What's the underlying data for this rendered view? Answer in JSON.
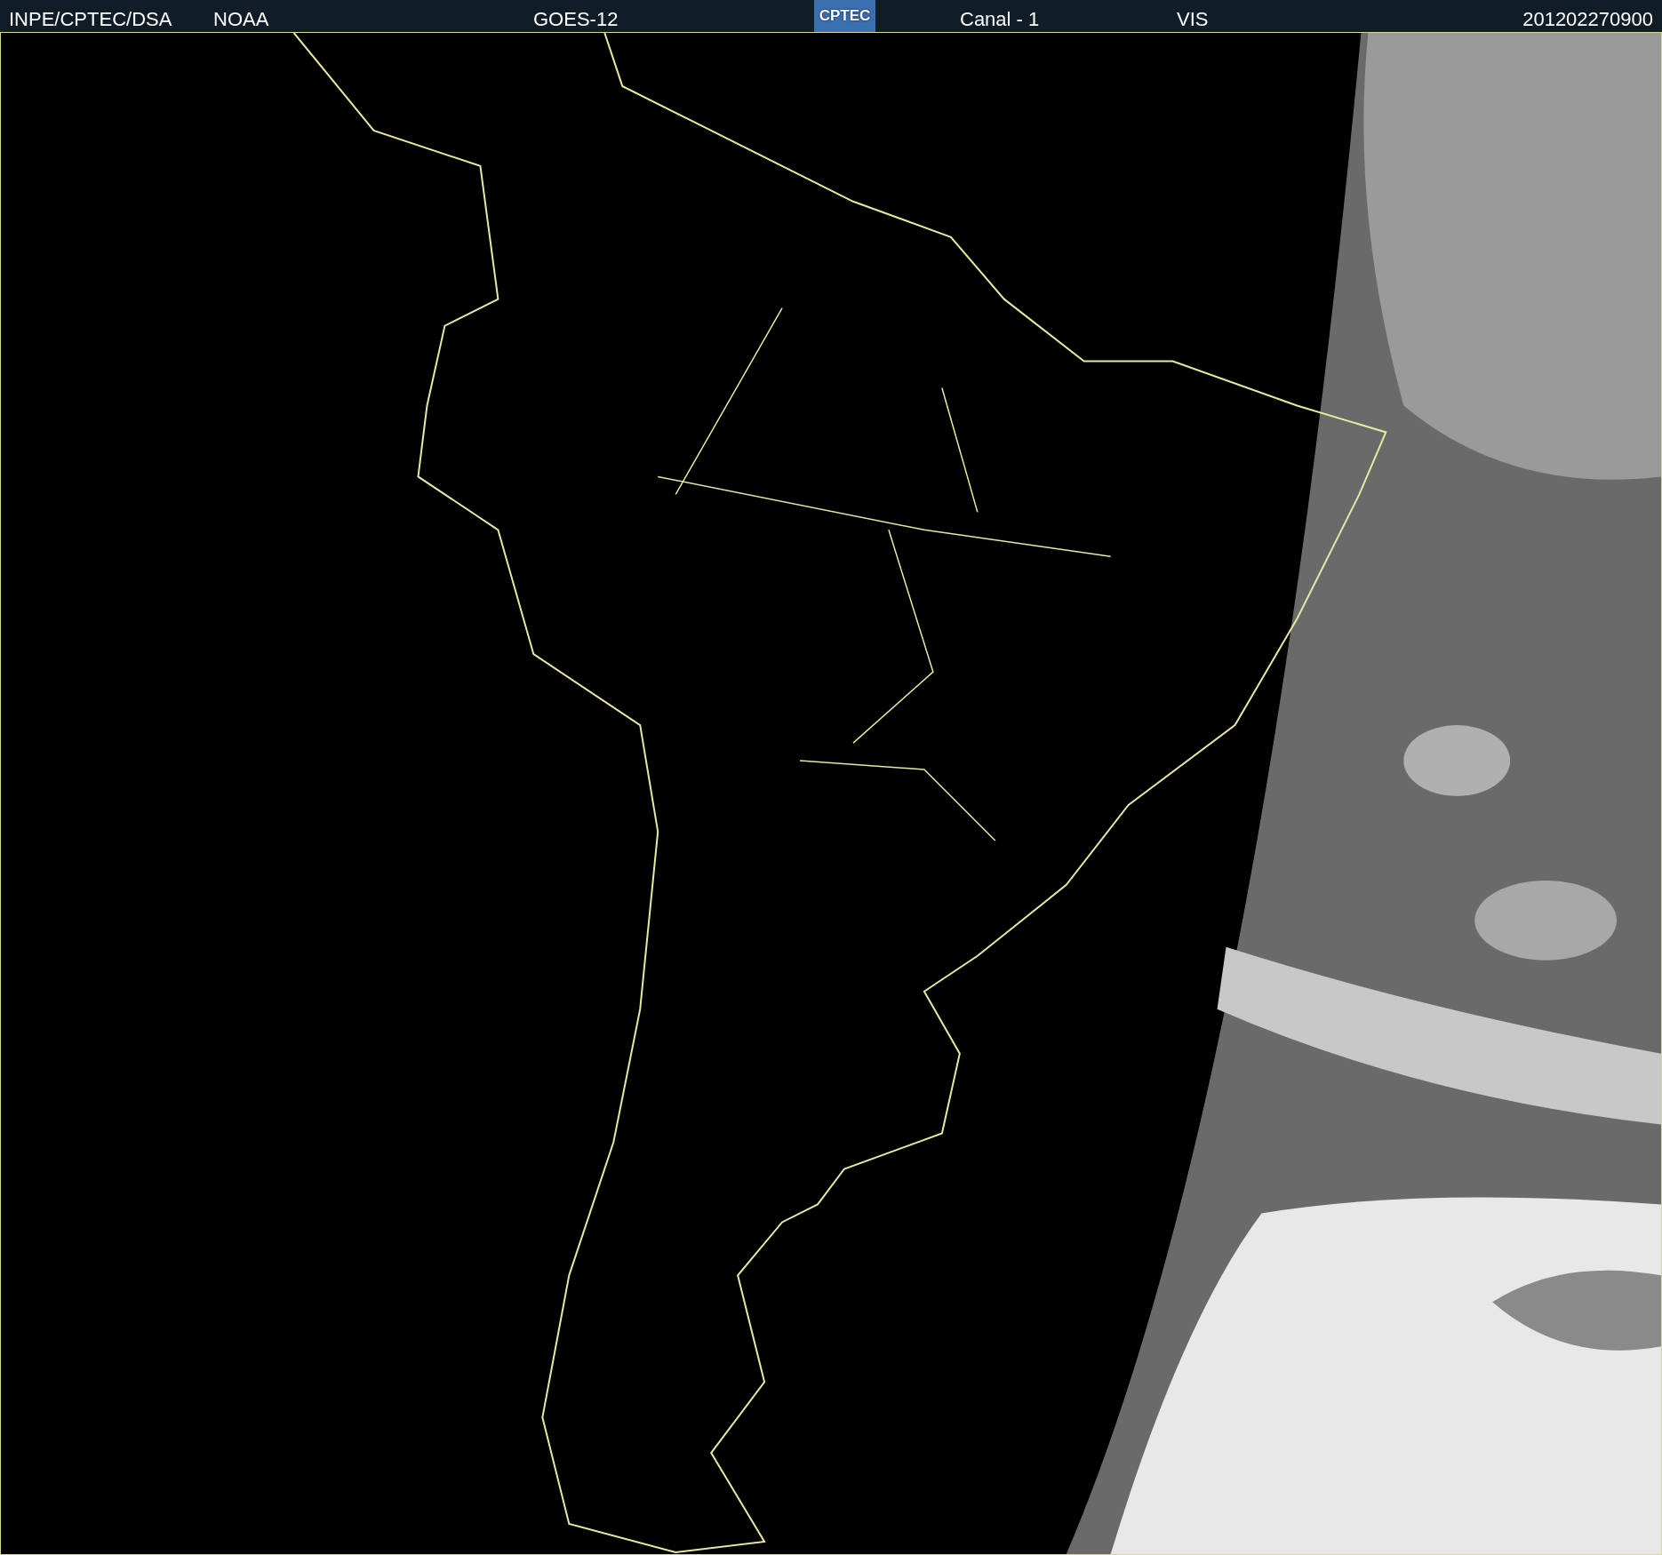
{
  "header": {
    "source": "INPE/CPTEC/DSA",
    "agency": "NOAA",
    "satellite": "GOES-12",
    "logo": "CPTEC",
    "channel": "Canal - 1",
    "band": "VIS",
    "timestamp": "201202270900"
  }
}
